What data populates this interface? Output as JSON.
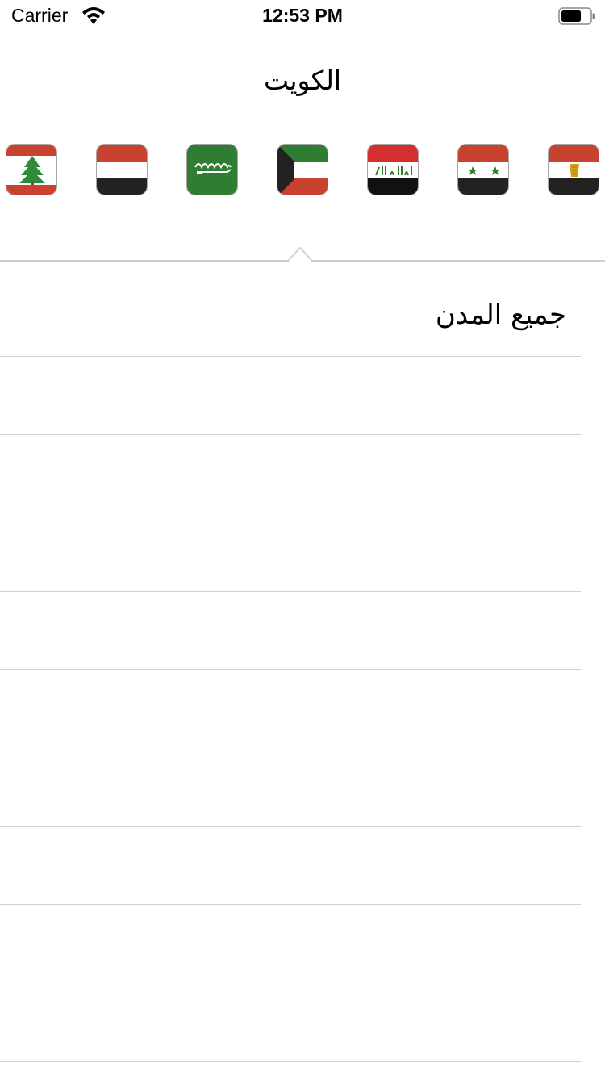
{
  "status_bar": {
    "carrier": "Carrier",
    "time": "12:53 PM",
    "wifi_icon": "wifi-icon",
    "battery_icon": "battery-icon"
  },
  "nav": {
    "title": "الكويت"
  },
  "flags": [
    {
      "name": "lebanon",
      "icon": "lebanon-flag-icon"
    },
    {
      "name": "yemen",
      "icon": "yemen-flag-icon"
    },
    {
      "name": "saudi-arabia",
      "icon": "saudi-flag-icon"
    },
    {
      "name": "kuwait",
      "icon": "kuwait-flag-icon",
      "selected": true
    },
    {
      "name": "iraq",
      "icon": "iraq-flag-icon"
    },
    {
      "name": "syria",
      "icon": "syria-flag-icon"
    },
    {
      "name": "egypt",
      "icon": "egypt-flag-icon"
    }
  ],
  "list": {
    "header_label": "جميع المدن",
    "empty_rows": 9
  },
  "colors": {
    "separator": "#cfcfd3",
    "flag_red": "#c9412f",
    "flag_green": "#2e7d32",
    "flag_black": "#222222"
  }
}
